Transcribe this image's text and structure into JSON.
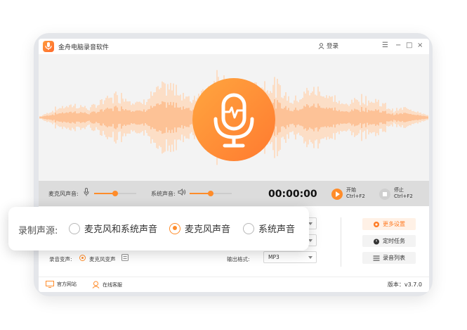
{
  "colors": {
    "accent": "#ff8c2a",
    "wave_light": "#ffd4b3",
    "wave_dark": "#ffb27a"
  },
  "app": {
    "title": "金舟电脑录音软件",
    "login": "登录"
  },
  "window_controls": {
    "menu": "☰",
    "minimize": "−",
    "maximize": "□",
    "close": "×"
  },
  "recording_bar": {
    "mic_label": "麦克风声音:",
    "mic_level": 0.5,
    "system_label": "系统声音:",
    "system_level": 0.5,
    "timer": "00:00:00",
    "start_label": "开始",
    "start_hotkey": "Ctrl+F2",
    "stop_label": "停止",
    "stop_hotkey": "Ctrl+F2"
  },
  "settings": {
    "voice_change_label": "录音变声:",
    "voice_change_value": "麦克风变声",
    "output_format_label": "输出格式:",
    "output_format_value": "MP3"
  },
  "side_buttons": {
    "more_settings": "更多设置",
    "scheduled_task": "定时任务",
    "record_list": "录音列表"
  },
  "footer": {
    "website": "官方网站",
    "support": "在线客服",
    "version": "版本：v3.7.0"
  },
  "popup": {
    "label": "录制声源:",
    "options": [
      "麦克风和系统声音",
      "麦克风声音",
      "系统声音"
    ],
    "selected_index": 1
  }
}
